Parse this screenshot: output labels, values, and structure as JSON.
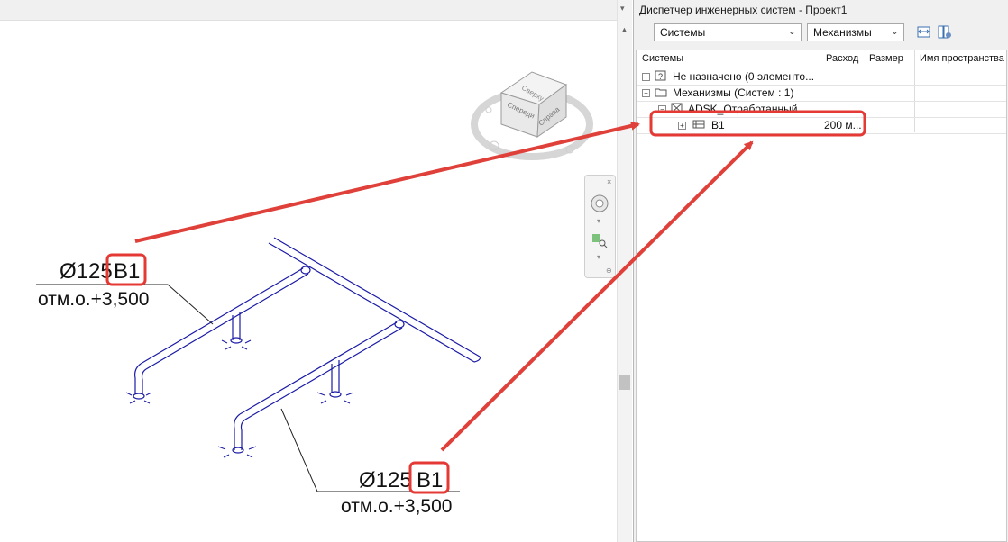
{
  "panel": {
    "title": "Диспетчер инженерных систем - Проект1",
    "filter_systems": "Системы",
    "filter_mechanisms": "Механизмы",
    "columns": [
      "Системы",
      "Расход",
      "Размер",
      "Имя пространства"
    ],
    "rows": [
      {
        "label": "Не назначено (0 элементо...",
        "expand": "+",
        "value": ""
      },
      {
        "label": "Механизмы (Систем : 1)",
        "expand": "−",
        "value": ""
      },
      {
        "label": "ADSK_Отработанный ...",
        "expand": "−",
        "value": ""
      },
      {
        "label": "В1",
        "expand": "+",
        "value": "200 м..."
      }
    ]
  },
  "viewcube": {
    "top": "Сверху",
    "front": "Спереди",
    "right": "Справа"
  },
  "annotations": [
    {
      "size": "Ø125",
      "tag": "В1",
      "elevation": "отм.о.+3,500"
    },
    {
      "size": "Ø125",
      "tag": "В1",
      "elevation": "отм.о.+3,500"
    }
  ],
  "colors": {
    "pipe": "#1a1aa6",
    "highlight": "#e53935",
    "arrow": "#e0403a"
  },
  "icons": [
    "dropdown-arrow",
    "tree-expand",
    "tree-collapse",
    "unassigned-icon",
    "folder-icon",
    "system-icon",
    "duct-icon",
    "viewcube",
    "steering-wheel",
    "zoom-region"
  ]
}
